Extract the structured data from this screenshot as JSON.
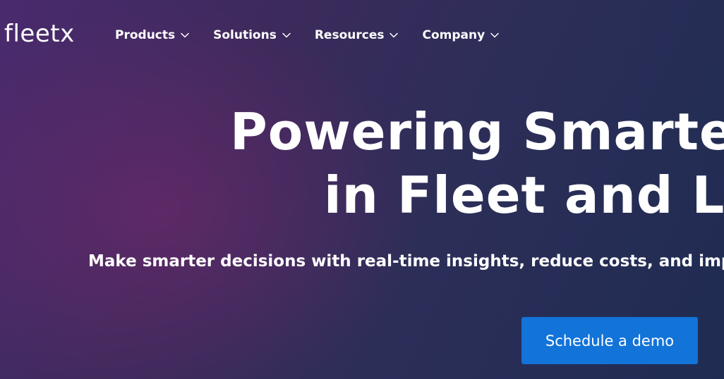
{
  "brand": {
    "logo_text": "fleetx"
  },
  "nav": {
    "items": [
      {
        "label": "Products",
        "icon": "chevron-down-icon"
      },
      {
        "label": "Solutions",
        "icon": "chevron-down-icon"
      },
      {
        "label": "Resources",
        "icon": "chevron-down-icon"
      },
      {
        "label": "Company",
        "icon": "chevron-down-icon"
      }
    ]
  },
  "hero": {
    "headline_line1": "Powering Smarter",
    "headline_line2": "in Fleet and Lo",
    "subtext": "Make smarter decisions with real-time insights, reduce costs, and impr",
    "cta_label": "Schedule a demo"
  },
  "colors": {
    "cta_background": "#1273d9",
    "text": "#ffffff",
    "background_start": "#4a2a6e",
    "background_end": "#1f2c52"
  }
}
